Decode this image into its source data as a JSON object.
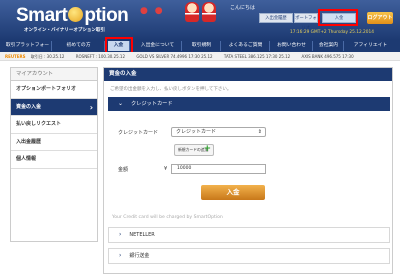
{
  "header": {
    "logo_pre": "Smart",
    "logo_post": "ption",
    "tagline": "オンライン・バイナリーオプション取引",
    "welcome": "こんにちは",
    "tab_account": "入出金履歴",
    "tab_portfolio": "ポートフォリオ",
    "tab_deposit": "入金",
    "logout": "ログアウト",
    "datetime": "17:16:29 GMT+2  Thursday 25.12.2014"
  },
  "nav": {
    "items": [
      "取引プラットフォーム",
      "初めての方",
      "入金",
      "入出金について",
      "取引規制",
      "よくあるご質問",
      "お問い合わせ",
      "会社案内",
      "アフィリエイト"
    ]
  },
  "ticker": {
    "brand": "REUTERS",
    "quotes": [
      "取引日 : 30.25.12",
      "ROSNEFT : 100.30.25.12",
      "GOLD VS SILVER 74.4996 17:30 25.12",
      "TATA STEEL 386.125 17:30 25.12",
      "AXIS BANK 496.575 17:30"
    ]
  },
  "sidebar": {
    "title": "マイアカウント",
    "items": [
      {
        "label": "オプションポートフォリオ"
      },
      {
        "label": "資金の入金"
      },
      {
        "label": "払い戻しリクエスト"
      },
      {
        "label": "入出金履歴"
      },
      {
        "label": "個人情報"
      }
    ]
  },
  "main": {
    "title": "資金の入金",
    "notice": "ご希望の出金額を入力し、払い戻しボタンを押して下さい。",
    "credit_card_label": "クレジットカード",
    "card_field_label": "クレジットカード",
    "card_select_value": "クレジットカード",
    "add_card": "新規カードの追加",
    "amount_label": "金額",
    "currency": "¥",
    "amount_value": "10000",
    "deposit_button": "入金",
    "charged_note": "Your Credit card will be charged by SmartOption",
    "neteller": "NETELLER",
    "bank": "銀行送金"
  }
}
